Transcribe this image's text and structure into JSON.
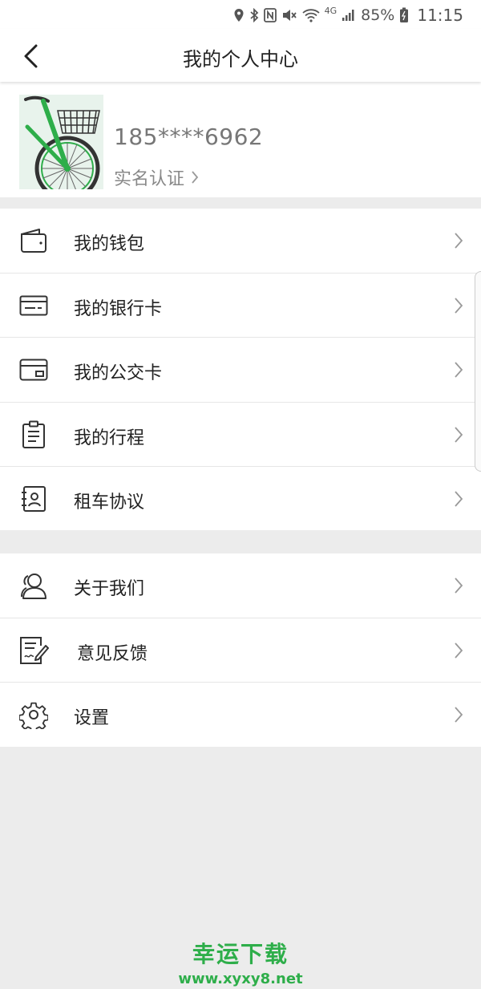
{
  "status_bar": {
    "battery": "85%",
    "time": "11:15",
    "network": "4G"
  },
  "header": {
    "title": "我的个人中心"
  },
  "profile": {
    "phone": "185****6962",
    "verify_label": "实名认证"
  },
  "menu_group1": [
    {
      "label": "我的钱包",
      "icon": "wallet-icon"
    },
    {
      "label": "我的银行卡",
      "icon": "bank-card-icon"
    },
    {
      "label": "我的公交卡",
      "icon": "bus-card-icon"
    },
    {
      "label": "我的行程",
      "icon": "trip-clipboard-icon"
    },
    {
      "label": "租车协议",
      "icon": "agreement-contact-icon"
    }
  ],
  "menu_group2": [
    {
      "label": "关于我们",
      "icon": "about-us-icon"
    },
    {
      "label": "意见反馈",
      "icon": "feedback-icon"
    },
    {
      "label": "设置",
      "icon": "settings-gear-icon"
    }
  ],
  "watermark": {
    "title": "幸运下载",
    "url": "www.xyxy8.net"
  },
  "colors": {
    "accent_green": "#2eae4a",
    "background": "#ececec"
  }
}
